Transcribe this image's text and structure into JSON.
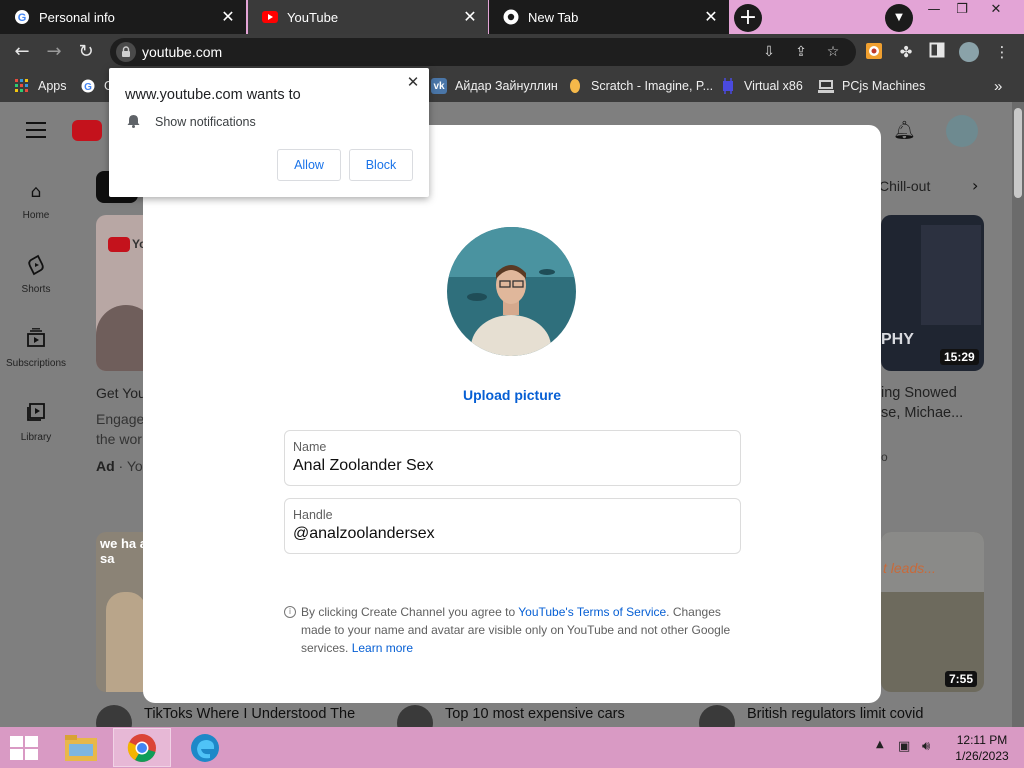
{
  "browser": {
    "tabs": [
      {
        "title": "Personal info",
        "icon": "google-icon"
      },
      {
        "title": "YouTube",
        "icon": "youtube-icon"
      },
      {
        "title": "New Tab",
        "icon": "chrome-icon"
      }
    ],
    "address": "youtube.com",
    "bookmarks": [
      {
        "label": "Apps",
        "icon": "apps-grid-icon"
      },
      {
        "label": "G",
        "icon": "google-icon"
      },
      {
        "label": "Айдар Зайнуллин",
        "icon": "vk-icon"
      },
      {
        "label": "Scratch - Imagine, P...",
        "icon": "scratch-icon"
      },
      {
        "label": "Virtual x86",
        "icon": "virtual-x86-icon"
      },
      {
        "label": "PCjs Machines",
        "icon": "pcjs-icon"
      }
    ],
    "bookmarks_overflow": "»"
  },
  "notification_prompt": {
    "title": "www.youtube.com wants to",
    "message": "Show notifications",
    "allow_label": "Allow",
    "block_label": "Block"
  },
  "youtube": {
    "sidebar": [
      {
        "label": "Home",
        "icon": "home-icon"
      },
      {
        "label": "Shorts",
        "icon": "shorts-icon"
      },
      {
        "label": "Subscriptions",
        "icon": "subscriptions-icon"
      },
      {
        "label": "Library",
        "icon": "library-icon"
      }
    ],
    "chip_partial": "Chill-out",
    "background": {
      "ad_title_partial": "Get You",
      "ad_desc_line1_partial": "Engage",
      "ad_desc_line2_partial": "the wor",
      "ad_label": "Ad",
      "ad_channel_partial": " · Yo",
      "right_title_line1": "ing Snowed",
      "right_title_line2": "se, Michae...",
      "right_meta_partial": "o",
      "thumb_logo_partial": "Yo",
      "thumb_overlay_left": "we ha at sa",
      "thumb_overlay_right": "t leads...",
      "thumb_text_phy": "PHY",
      "duration_top": "15:29",
      "duration_bottom": "7:55",
      "bottom_titles": [
        "TikToks Where I Understood The",
        "Top 10 most expensive cars",
        "British regulators limit covid"
      ]
    }
  },
  "create_channel": {
    "upload_label": "Upload picture",
    "name_label": "Name",
    "name_value": "Anal Zoolander Sex",
    "handle_label": "Handle",
    "handle_value": "@analzoolandersex",
    "legal_prefix": "By clicking Create Channel you agree to ",
    "legal_link": "YouTube's Terms of Service",
    "legal_suffix": ". Changes made to your name and avatar are visible only on YouTube and not other Google services. ",
    "learn_more": "Learn more"
  },
  "taskbar": {
    "apps": [
      "file-explorer-icon",
      "chrome-icon",
      "edge-icon"
    ],
    "time": "12:11 PM",
    "date": "1/26/2023"
  },
  "colors": {
    "tab_strip": "#e3a4d6",
    "taskbar": "#d99ac4",
    "link_blue": "#065fd4",
    "youtube_red": "#c4121c"
  }
}
